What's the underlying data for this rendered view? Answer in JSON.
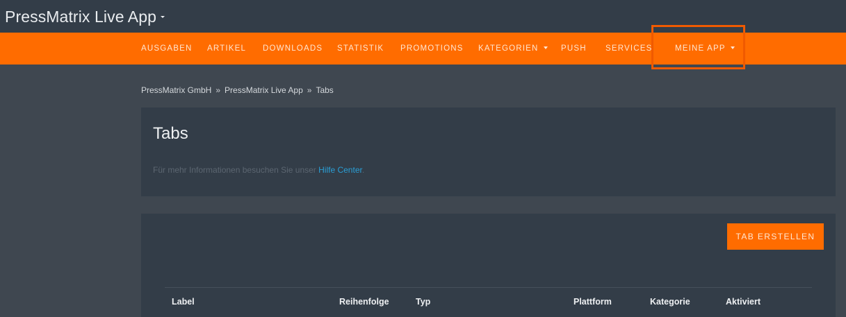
{
  "header": {
    "app_title": "PressMatrix Live App"
  },
  "nav": {
    "items": [
      {
        "label": "AUSGABEN"
      },
      {
        "label": "ARTIKEL"
      },
      {
        "label": "DOWNLOADS"
      },
      {
        "label": "STATISTIK"
      },
      {
        "label": "PROMOTIONS"
      },
      {
        "label": "KATEGORIEN"
      },
      {
        "label": "PUSH"
      },
      {
        "label": "SERVICES"
      },
      {
        "label": "MEINE APP"
      }
    ]
  },
  "breadcrumb": {
    "items": [
      "PressMatrix GmbH",
      "PressMatrix Live App",
      "Tabs"
    ],
    "separator": "»"
  },
  "page": {
    "title": "Tabs",
    "info_prefix": "Für mehr Informationen besuchen Sie unser ",
    "info_link": "Hilfe Center",
    "info_suffix": "."
  },
  "actions": {
    "create_tab": "TAB ERSTELLEN"
  },
  "table": {
    "columns": [
      "Label",
      "Reihenfolge",
      "Typ",
      "Plattform",
      "Kategorie",
      "Aktiviert"
    ]
  },
  "colors": {
    "accent": "#ff6c00",
    "highlight": "#f05a00",
    "link": "#2a9fd6"
  }
}
